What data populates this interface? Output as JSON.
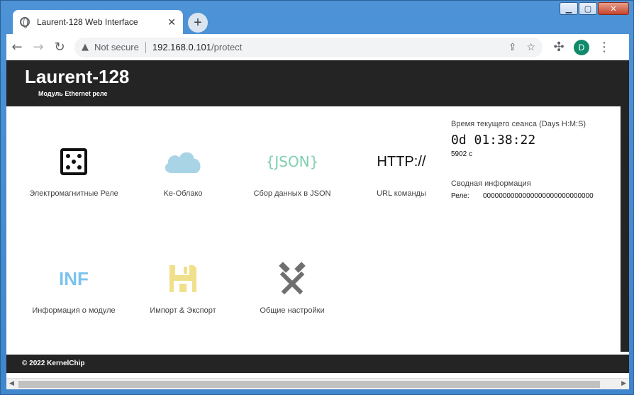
{
  "browser": {
    "tab_title": "Laurent-128 Web Interface",
    "tab_close": "✕",
    "new_tab": "+",
    "security_label": "Not secure",
    "url_host": "192.168.0.101",
    "url_path": "/protect",
    "avatar_initial": "D"
  },
  "header": {
    "title": "Laurent-128",
    "subtitle": "Модуль Ethernet реле"
  },
  "tiles": [
    {
      "label": "Электромагнитные Реле",
      "icon": "dice-icon"
    },
    {
      "label": "Ke-Облако",
      "icon": "cloud-icon"
    },
    {
      "label": "Сбор данных в JSON",
      "icon": "json-icon",
      "icon_text": "{JSON}"
    },
    {
      "label": "URL команды",
      "icon": "http-icon",
      "icon_text": "HTTP://"
    },
    {
      "label": "Информация о модуле",
      "icon": "inf-icon",
      "icon_text": "INF"
    },
    {
      "label": "Импорт & Экспорт",
      "icon": "floppy-icon"
    },
    {
      "label": "Общие настройки",
      "icon": "tools-icon"
    }
  ],
  "session": {
    "heading": "Время текущего сеанса (Days H:M:S)",
    "time": "0d 01:38:22",
    "seconds": "5902 с"
  },
  "summary": {
    "heading": "Сводная информация",
    "relay_label": "Реле:",
    "relay_value": "0000000000000000000000000000"
  },
  "footer": {
    "copyright": "© 2022 KernelChip"
  },
  "colors": {
    "header_bg": "#242424",
    "cloud": "#a8d4e6",
    "json": "#7fcfb0",
    "inf": "#7cc3ee",
    "floppy": "#f0e08a",
    "tools": "#6f6f6f"
  }
}
